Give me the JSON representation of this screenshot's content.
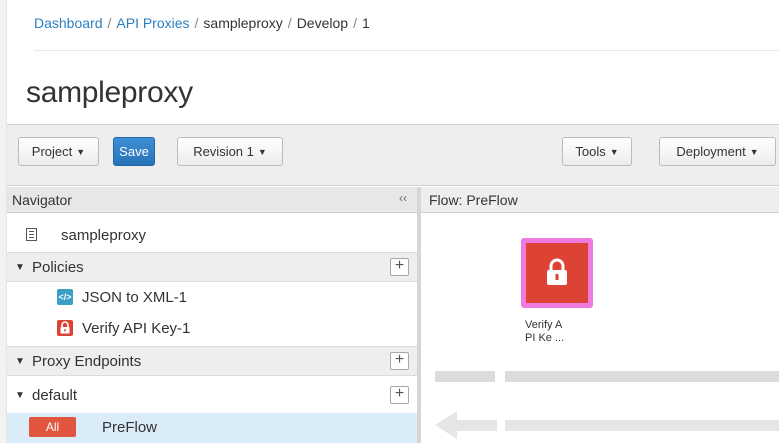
{
  "breadcrumb": {
    "items": [
      {
        "label": "Dashboard",
        "link": true
      },
      {
        "label": "API Proxies",
        "link": true
      },
      {
        "label": "sampleproxy",
        "link": false
      },
      {
        "label": "Develop",
        "link": false
      },
      {
        "label": "1",
        "link": false
      }
    ],
    "separator": "/"
  },
  "page": {
    "title": "sampleproxy"
  },
  "toolbar": {
    "project_label": "Project",
    "save_label": "Save",
    "revision_label": "Revision 1",
    "tools_label": "Tools",
    "deployment_label": "Deployment"
  },
  "navigator": {
    "title": "Navigator",
    "collapse_glyph": "‹‹",
    "proxy_name": "sampleproxy",
    "policies_label": "Policies",
    "policies": [
      {
        "label": "JSON to XML-1",
        "icon": "json-to-xml-icon",
        "color": "#3a9fc5"
      },
      {
        "label": "Verify API Key-1",
        "icon": "lock-icon",
        "color": "#dd4334"
      }
    ],
    "proxy_endpoints_label": "Proxy Endpoints",
    "endpoint_name": "default",
    "flow_badge": "All",
    "flow_label": "PreFlow"
  },
  "flow": {
    "header": "Flow: PreFlow",
    "policy_label_line1": "Verify A",
    "policy_label_line2": "PI Ke ..."
  },
  "colors": {
    "link": "#2a7fc2",
    "primary_button": "#2873b8",
    "policy_tile_border": "#ee7bdd",
    "policy_tile_fill": "#dd4334",
    "badge": "#e2553e",
    "selected_row": "#d9ecf8"
  }
}
